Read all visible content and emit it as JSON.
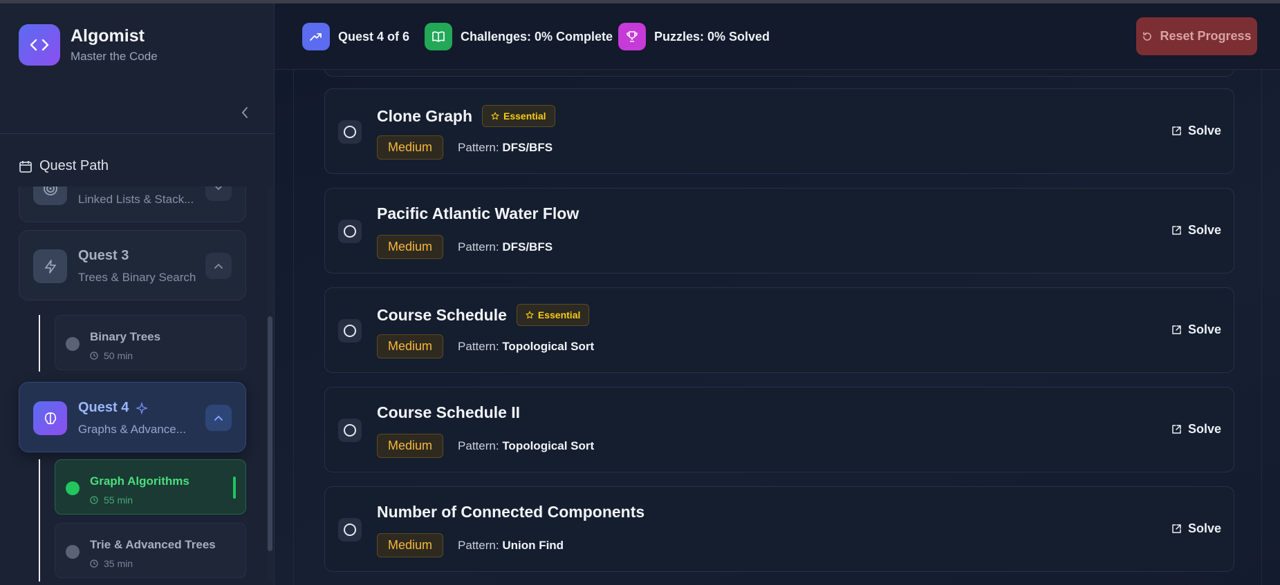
{
  "brand": {
    "title": "Algomist",
    "subtitle": "Master the Code"
  },
  "sidebar": {
    "section_label": "Quest Path",
    "quests": [
      {
        "title": "",
        "subtitle": "Linked Lists & Stack...",
        "icon": "target-icon"
      },
      {
        "title": "Quest 3",
        "subtitle": "Trees & Binary Search",
        "icon": "lightning-icon"
      },
      {
        "title": "Quest 4",
        "subtitle": "Graphs & Advance...",
        "icon": "brain-icon"
      }
    ],
    "topics": [
      {
        "title": "Binary Trees",
        "time": "50 min"
      },
      {
        "title": "Graph Algorithms",
        "time": "55 min"
      },
      {
        "title": "Trie & Advanced Trees",
        "time": "35 min"
      }
    ]
  },
  "topbar": {
    "quest_progress": "Quest 4 of 6",
    "challenges": "Challenges: 0% Complete",
    "puzzles": "Puzzles: 0% Solved",
    "reset_label": "Reset Progress",
    "colors": {
      "quest": "#5b6cf0",
      "challenges": "#22c55e",
      "puzzles": "#d946ef",
      "reset": "#7c2f33"
    }
  },
  "problems": [
    {
      "title": "Clone Graph",
      "essential": "Essential",
      "difficulty": "Medium",
      "pattern_label": "Pattern:",
      "pattern": "DFS/BFS",
      "action": "Solve"
    },
    {
      "title": "Pacific Atlantic Water Flow",
      "essential": "",
      "difficulty": "Medium",
      "pattern_label": "Pattern:",
      "pattern": "DFS/BFS",
      "action": "Solve"
    },
    {
      "title": "Course Schedule",
      "essential": "Essential",
      "difficulty": "Medium",
      "pattern_label": "Pattern:",
      "pattern": "Topological Sort",
      "action": "Solve"
    },
    {
      "title": "Course Schedule II",
      "essential": "",
      "difficulty": "Medium",
      "pattern_label": "Pattern:",
      "pattern": "Topological Sort",
      "action": "Solve"
    },
    {
      "title": "Number of Connected Components",
      "essential": "",
      "difficulty": "Medium",
      "pattern_label": "Pattern:",
      "pattern": "Union Find",
      "action": "Solve"
    }
  ]
}
